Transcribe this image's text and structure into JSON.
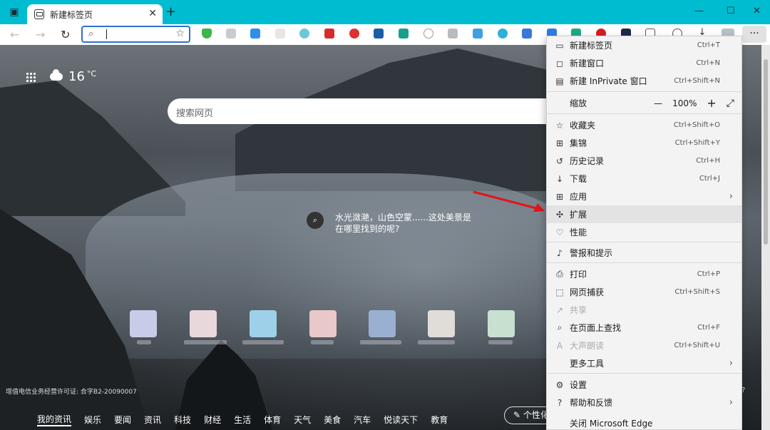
{
  "tab": {
    "title": "新建标签页"
  },
  "weather": {
    "temp": "16",
    "unit": "°C"
  },
  "search": {
    "placeholder": "搜索网页"
  },
  "tip": {
    "text": "水光潋滟，山色空蒙......这处美景是在哪里找到的呢?"
  },
  "license": "增值电信业务经营许可证: 合字B2-20090007",
  "news_tabs": [
    "我的资讯",
    "娱乐",
    "要闻",
    "资讯",
    "科技",
    "财经",
    "生活",
    "体育",
    "天气",
    "美食",
    "汽车",
    "悦读天下",
    "教育"
  ],
  "personalize_label": "个性化",
  "menu": {
    "items": [
      {
        "label": "新建标签页",
        "shortcut": "Ctrl+T"
      },
      {
        "label": "新建窗口",
        "shortcut": "Ctrl+N"
      },
      {
        "label": "新建 InPrivate 窗口",
        "shortcut": "Ctrl+Shift+N"
      },
      {
        "label": "缩放"
      },
      {
        "label": "收藏夹",
        "shortcut": "Ctrl+Shift+O"
      },
      {
        "label": "集锦",
        "shortcut": "Ctrl+Shift+Y"
      },
      {
        "label": "历史记录",
        "shortcut": "Ctrl+H"
      },
      {
        "label": "下载",
        "shortcut": "Ctrl+J"
      },
      {
        "label": "应用"
      },
      {
        "label": "扩展"
      },
      {
        "label": "性能"
      },
      {
        "label": "警报和提示"
      },
      {
        "label": "打印",
        "shortcut": "Ctrl+P"
      },
      {
        "label": "网页捕获",
        "shortcut": "Ctrl+Shift+S"
      },
      {
        "label": "共享"
      },
      {
        "label": "在页面上查找",
        "shortcut": "Ctrl+F"
      },
      {
        "label": "大声朗读",
        "shortcut": "Ctrl+Shift+U"
      },
      {
        "label": "更多工具"
      },
      {
        "label": "设置"
      },
      {
        "label": "帮助和反馈"
      },
      {
        "label": "关闭 Microsoft Edge"
      }
    ],
    "zoom": {
      "minus": "—",
      "value": "100%",
      "plus": "+",
      "fullscreen": "⤢"
    }
  },
  "colors": {
    "accent": "#00bcd0",
    "arrow": "#e0161a",
    "address_border": "#2f6fd4"
  }
}
